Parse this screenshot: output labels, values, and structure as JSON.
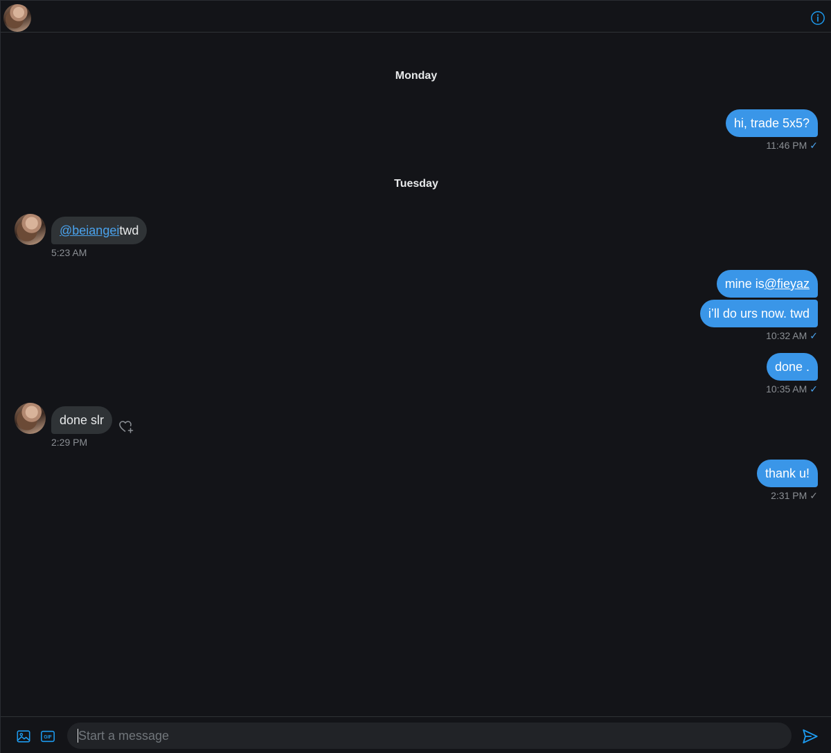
{
  "header": {
    "avatar_icon": "user-avatar",
    "info_icon": "info-icon"
  },
  "conversation": {
    "days": [
      "Monday",
      "Tuesday"
    ],
    "messages": [
      {
        "direction": "out",
        "text": "hi, trade 5x5?",
        "time": "11:46 PM",
        "status": "✓"
      },
      {
        "direction": "in",
        "mention": "@beiangei",
        "text": " twd",
        "time": "5:23 AM"
      },
      {
        "direction": "out",
        "prefix": "mine is ",
        "mention": "@fieyaz"
      },
      {
        "direction": "out",
        "text": "i’ll do urs now. twd",
        "time": "10:32 AM",
        "status": "✓"
      },
      {
        "direction": "out",
        "text": "done .",
        "time": "10:35 AM",
        "status": "✓"
      },
      {
        "direction": "in",
        "text": "done slr",
        "time": "2:29 PM",
        "reaction_icon": "heart-plus-icon"
      },
      {
        "direction": "out",
        "text": "thank u!",
        "time": "2:31 PM",
        "status": "✓"
      }
    ]
  },
  "composer": {
    "placeholder": "Start a message",
    "value": "",
    "image_icon": "image-icon",
    "gif_icon": "gif-icon",
    "gif_label": "GIF",
    "send_icon": "send-icon"
  },
  "colors": {
    "background": "#131418",
    "accent": "#3a96e8",
    "incoming_bubble": "#2f3336",
    "muted_text": "#8b8f94"
  }
}
